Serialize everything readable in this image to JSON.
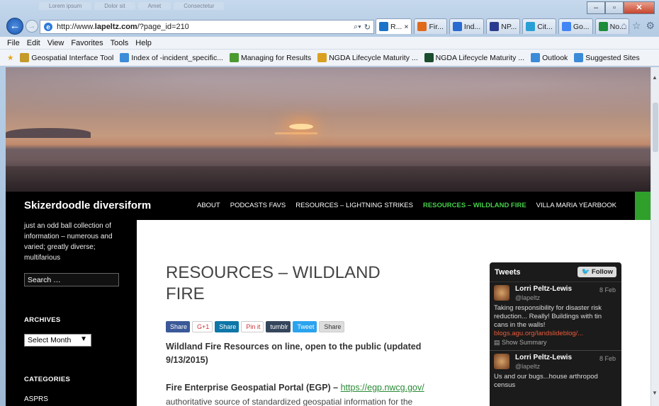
{
  "browser": {
    "bg_tabs": [
      "Lorem ipsum",
      "Dolor sit",
      "Amet",
      "Consectetur"
    ],
    "url_plain": "http://www.",
    "url_host": "lapeltz.com",
    "url_path": "/?page_id=210",
    "tabs": [
      {
        "label": "R...",
        "icon_color": "#1a73c8",
        "active": true
      },
      {
        "label": "Fir...",
        "icon_color": "#e06a1b",
        "active": false
      },
      {
        "label": "Ind...",
        "icon_color": "#2a6bd1",
        "active": false
      },
      {
        "label": "NP...",
        "icon_color": "#2a3b8f",
        "active": false
      },
      {
        "label": "Cit...",
        "icon_color": "#2a9fd6",
        "active": false
      },
      {
        "label": "Go...",
        "icon_color": "#4285f4",
        "active": false
      },
      {
        "label": "No...",
        "icon_color": "#1e8c3a",
        "active": false
      }
    ],
    "menu": [
      "File",
      "Edit",
      "View",
      "Favorites",
      "Tools",
      "Help"
    ],
    "favorites": [
      {
        "label": "Geospatial Interface Tool",
        "icon": "geoplatform-icon",
        "color": "#c49a2a"
      },
      {
        "label": "Index of -incident_specific...",
        "icon": "ie-page-icon",
        "color": "#3c8bd8"
      },
      {
        "label": "Managing for Results",
        "icon": "mfr-icon",
        "color": "#4a9a30"
      },
      {
        "label": "NGDA Lifecycle Maturity ...",
        "icon": "ngda-icon",
        "color": "#d9a020"
      },
      {
        "label": "NGDA Lifecycle Maturity ...",
        "icon": "ngda-square-icon",
        "color": "#1a4d2e"
      },
      {
        "label": "Outlook",
        "icon": "ie-page-icon",
        "color": "#3c8bd8"
      },
      {
        "label": "Suggested Sites",
        "icon": "ie-page-icon",
        "color": "#3c8bd8"
      }
    ]
  },
  "site": {
    "title": "Skizerdoodle diversiform",
    "nav": [
      {
        "label": "ABOUT",
        "active": false
      },
      {
        "label": "PODCASTS FAVS",
        "active": false
      },
      {
        "label": "RESOURCES – LIGHTNING STRIKES",
        "active": false
      },
      {
        "label": "RESOURCES – WILDLAND FIRE",
        "active": true
      },
      {
        "label": "VILLA MARIA YEARBOOK",
        "active": false
      }
    ],
    "accent": "#45d04a"
  },
  "sidebar": {
    "tagline": "just an odd ball collection of information – numerous and varied; greatly diverse; multifarious",
    "search_placeholder": "Search …",
    "archives_heading": "ARCHIVES",
    "archives_select": "Select Month",
    "categories_heading": "CATEGORIES",
    "first_category": "ASPRS"
  },
  "content": {
    "title": "RESOURCES – WILDLAND FIRE",
    "share": [
      {
        "label": "Share",
        "color": "#3b5998",
        "icon": "facebook-icon"
      },
      {
        "label": "G+1",
        "color": "#fff",
        "icon": "googleplus-icon"
      },
      {
        "label": "Share",
        "color": "#0e76a8",
        "icon": "linkedin-icon"
      },
      {
        "label": "Pin it",
        "color": "#fff",
        "icon": "pinterest-icon"
      },
      {
        "label": "tumblr",
        "color": "#35465c",
        "icon": "tumblr-icon"
      },
      {
        "label": "Tweet",
        "color": "#2aa3ef",
        "icon": "twitter-icon"
      },
      {
        "label": "Share",
        "color": "#ddd",
        "icon": "share-icon"
      }
    ],
    "intro": "Wildland Fire Resources on line, open to the public (updated 9/13/2015)",
    "egp_label": "Fire Enterprise Geospatial Portal (EGP) – ",
    "egp_link": "https://egp.nwcg.gov/",
    "egp_desc": "authoritative source of standardized geospatial information for the"
  },
  "tweets": {
    "heading": "Tweets",
    "follow": "Follow",
    "items": [
      {
        "name": "Lorri Peltz-Lewis",
        "handle": "@lapeltz",
        "date": "8 Feb",
        "text": "Taking responsibility for disaster risk reduction... Really! Buildings with tin cans in the walls!",
        "link": "blogs.agu.org/landslideblog/...",
        "summary": "Show Summary"
      },
      {
        "name": "Lorri Peltz-Lewis",
        "handle": "@lapeltz",
        "date": "8 Feb",
        "text": "Us and our bugs...house arthropod census",
        "link": "",
        "summary": ""
      }
    ]
  }
}
